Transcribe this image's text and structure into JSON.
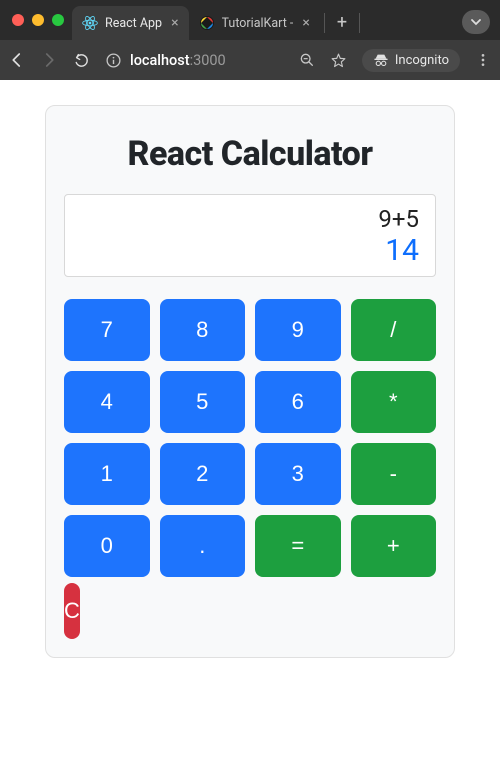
{
  "browser": {
    "tabs": [
      {
        "title": "React App",
        "active": true,
        "favicon": "react"
      },
      {
        "title": "TutorialKart - ",
        "active": false,
        "favicon": "tk"
      }
    ],
    "url": {
      "host": "localhost",
      "path": ":3000"
    },
    "incognito_label": "Incognito"
  },
  "calculator": {
    "title": "React Calculator",
    "expression": "9+5",
    "result": "14",
    "keys": [
      {
        "label": "7",
        "kind": "num",
        "name": "key-7"
      },
      {
        "label": "8",
        "kind": "num",
        "name": "key-8"
      },
      {
        "label": "9",
        "kind": "num",
        "name": "key-9"
      },
      {
        "label": "/",
        "kind": "op",
        "name": "key-divide"
      },
      {
        "label": "4",
        "kind": "num",
        "name": "key-4"
      },
      {
        "label": "5",
        "kind": "num",
        "name": "key-5"
      },
      {
        "label": "6",
        "kind": "num",
        "name": "key-6"
      },
      {
        "label": "*",
        "kind": "op",
        "name": "key-multiply"
      },
      {
        "label": "1",
        "kind": "num",
        "name": "key-1"
      },
      {
        "label": "2",
        "kind": "num",
        "name": "key-2"
      },
      {
        "label": "3",
        "kind": "num",
        "name": "key-3"
      },
      {
        "label": "-",
        "kind": "op",
        "name": "key-subtract"
      },
      {
        "label": "0",
        "kind": "num",
        "name": "key-0"
      },
      {
        "label": ".",
        "kind": "num",
        "name": "key-decimal"
      },
      {
        "label": "=",
        "kind": "op",
        "name": "key-equals"
      },
      {
        "label": "+",
        "kind": "op",
        "name": "key-add"
      }
    ],
    "clear_label": "C"
  }
}
